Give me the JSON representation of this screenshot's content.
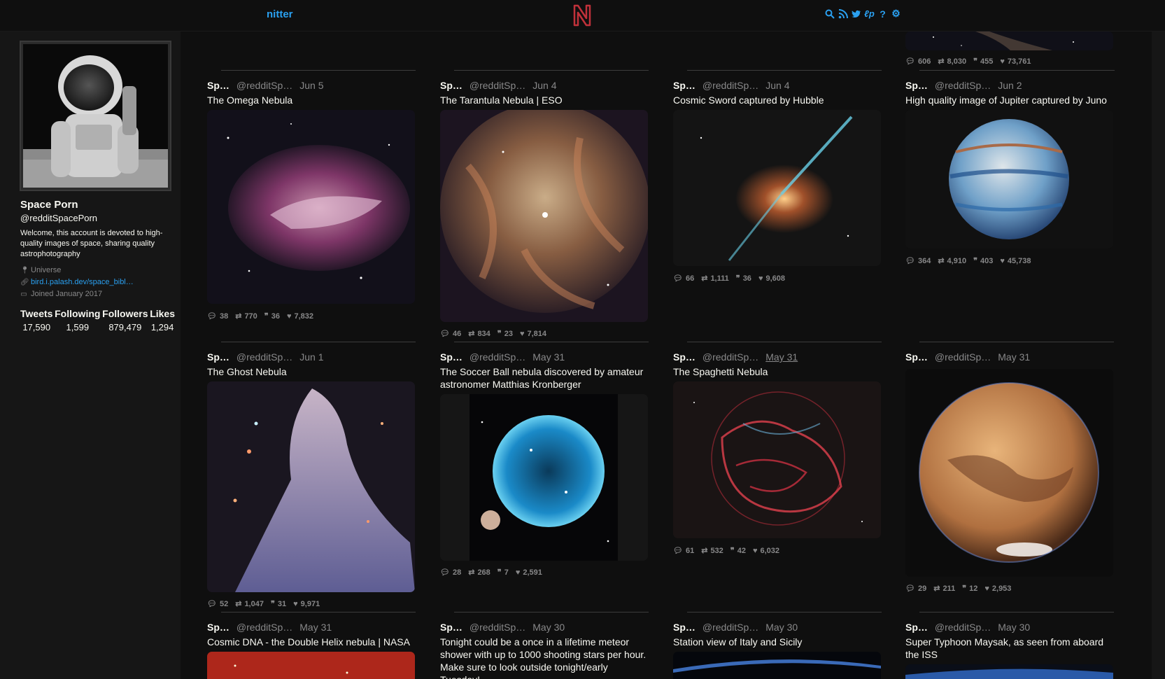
{
  "nav": {
    "brand": "nitter",
    "icons": [
      "search-icon",
      "rss-icon",
      "twitter-icon",
      "pleroma-icon",
      "help-icon",
      "gear-icon"
    ],
    "accent": "#2aa0f0",
    "logo_color": "#c0313a"
  },
  "profile": {
    "name": "Space Porn",
    "handle": "@redditSpacePorn",
    "bio": "Welcome, this account is devoted to high-quality images of space, sharing quality astrophotography",
    "location": "Universe",
    "website": "bird.i.palash.dev/space_bibl…",
    "joined": "Joined January 2017",
    "stats": [
      {
        "label": "Tweets",
        "value": "17,590"
      },
      {
        "label": "Following",
        "value": "1,599"
      },
      {
        "label": "Followers",
        "value": "879,479"
      },
      {
        "label": "Likes",
        "value": "1,294"
      }
    ]
  },
  "tweets": [
    {
      "fullname": "Sp…",
      "username": "@redditSp…",
      "date": "",
      "text": "",
      "stats": {
        "replies": "606",
        "retweets": "8,030",
        "quotes": "455",
        "likes": "73,761"
      }
    },
    {
      "fullname": "Sp…",
      "username": "@redditSp…",
      "date": "Jun 5",
      "text": "The Omega Nebula",
      "stats": {
        "replies": "38",
        "retweets": "770",
        "quotes": "36",
        "likes": "7,832"
      }
    },
    {
      "fullname": "Sp…",
      "username": "@redditSp…",
      "date": "Jun 4",
      "text": "The Tarantula Nebula | ESO",
      "stats": {
        "replies": "46",
        "retweets": "834",
        "quotes": "23",
        "likes": "7,814"
      }
    },
    {
      "fullname": "Sp…",
      "username": "@redditSp…",
      "date": "Jun 4",
      "text": "Cosmic Sword captured by Hubble",
      "stats": {
        "replies": "66",
        "retweets": "1,111",
        "quotes": "36",
        "likes": "9,608"
      }
    },
    {
      "fullname": "Sp…",
      "username": "@redditSp…",
      "date": "Jun 2",
      "text": "High quality image of Jupiter captured by Juno",
      "stats": {
        "replies": "364",
        "retweets": "4,910",
        "quotes": "403",
        "likes": "45,738"
      }
    },
    {
      "fullname": "Sp…",
      "username": "@redditSp…",
      "date": "Jun 1",
      "text": "The Ghost Nebula",
      "stats": {
        "replies": "52",
        "retweets": "1,047",
        "quotes": "31",
        "likes": "9,971"
      }
    },
    {
      "fullname": "Sp…",
      "username": "@redditSp…",
      "date": "May 31",
      "text": "The Soccer Ball nebula discovered by amateur astronomer Matthias Kronberger",
      "stats": {
        "replies": "28",
        "retweets": "268",
        "quotes": "7",
        "likes": "2,591"
      }
    },
    {
      "fullname": "Sp…",
      "username": "@redditSp…",
      "date": "May 31",
      "text": "The Spaghetti Nebula",
      "stats": {
        "replies": "61",
        "retweets": "532",
        "quotes": "42",
        "likes": "6,032"
      }
    },
    {
      "fullname": "Sp…",
      "username": "@redditSp…",
      "date": "May 31",
      "text": "",
      "stats": {
        "replies": "29",
        "retweets": "211",
        "quotes": "12",
        "likes": "2,953"
      }
    },
    {
      "fullname": "Sp…",
      "username": "@redditSp…",
      "date": "May 31",
      "text": "Cosmic DNA - the Double Helix nebula | NASA",
      "stats": {}
    },
    {
      "fullname": "Sp…",
      "username": "@redditSp…",
      "date": "May 30",
      "text": "Tonight could be a once in a lifetime meteor shower with up to 1000 shooting stars per hour. Make sure to look outside tonight/early Tuesday!",
      "stats": {}
    },
    {
      "fullname": "Sp…",
      "username": "@redditSp…",
      "date": "May 30",
      "text": "Station view of Italy and Sicily",
      "stats": {}
    },
    {
      "fullname": "Sp…",
      "username": "@redditSp…",
      "date": "May 30",
      "text": "Super Typhoon Maysak, as seen from aboard the ISS",
      "stats": {}
    }
  ]
}
